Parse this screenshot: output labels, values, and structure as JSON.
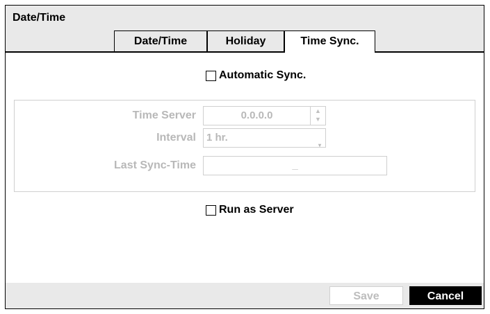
{
  "window": {
    "title": "Date/Time"
  },
  "tabs": [
    {
      "label": "Date/Time",
      "active": false
    },
    {
      "label": "Holiday",
      "active": false
    },
    {
      "label": "Time Sync.",
      "active": true
    }
  ],
  "sync": {
    "automatic_label": "Automatic Sync.",
    "automatic_checked": false,
    "time_server_label": "Time Server",
    "time_server_value": "0.0.0.0",
    "interval_label": "Interval",
    "interval_value": "1 hr.",
    "last_sync_label": "Last Sync-Time",
    "last_sync_value": "_"
  },
  "server": {
    "run_as_server_label": "Run as Server",
    "run_as_server_checked": false
  },
  "footer": {
    "save_label": "Save",
    "cancel_label": "Cancel"
  },
  "colors": {
    "disabled_text": "#b8b8b8",
    "frame": "#e9e9e9",
    "cancel_bg": "#000000"
  },
  "icons": {
    "spinner": "spinner-arrows-icon",
    "dropdown": "dropdown-arrow-icon",
    "checkbox": "checkbox-icon"
  }
}
